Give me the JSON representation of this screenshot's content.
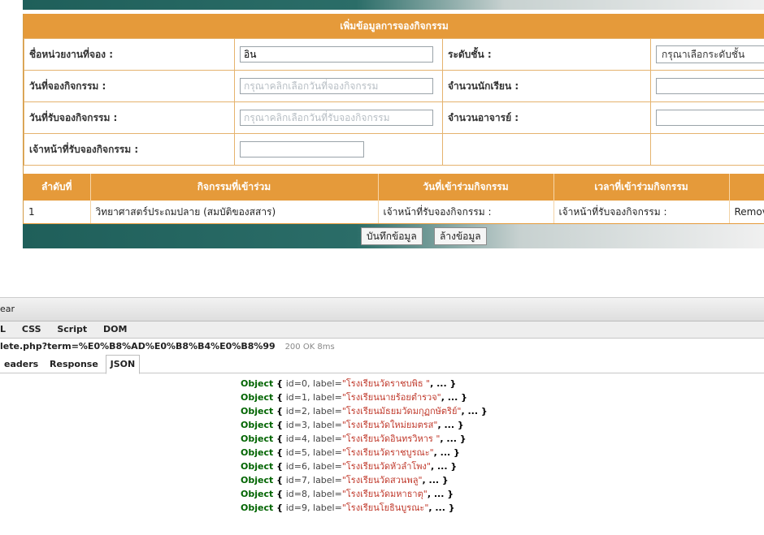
{
  "form": {
    "header": "เพิ่มข้อมูลการจองกิจกรรม",
    "rows": [
      {
        "label": "ชื่อหน่วยงานที่จอง :",
        "value": "อิน",
        "placeholder": "",
        "label2": "ระดับชั้น :",
        "select_value": "กรุณาเลือกระดับชั้น"
      },
      {
        "label": "วันที่จองกิจกรรม :",
        "value": "",
        "placeholder": "กรุณาคลิกเลือกวันที่จองกิจกรรม",
        "label2": "จำนวนนักเรียน :",
        "value2": ""
      },
      {
        "label": "วันที่รับจองกิจกรรม :",
        "value": "",
        "placeholder": "กรุณาคลิกเลือกวันที่รับจองกิจกรรม",
        "label2": "จำนวนอาจารย์ :",
        "value2": ""
      },
      {
        "label": "เจ้าหน้าที่รับจองกิจกรรม :",
        "value": ""
      }
    ]
  },
  "activities": {
    "headers": [
      "ลำดับที่",
      "กิจกรรมที่เข้าร่วม",
      "วันที่เข้าร่วมกิจกรรม",
      "เวลาที่เข้าร่วมกิจกรรม",
      ""
    ],
    "rows": [
      {
        "no": "1",
        "activity": "วิทยาศาสตร์ประถมปลาย (สมบัติของสสาร)",
        "date": "เจ้าหน้าที่รับจองกิจกรรม :",
        "time": "เจ้าหน้าที่รับจองกิจกรรม :",
        "action": "Remove"
      }
    ]
  },
  "buttons": {
    "save": "บันทึกข้อมูล",
    "clear": "ล้างข้อมูล"
  },
  "devtools": {
    "toolbar_text": "ear",
    "tabs": [
      "L",
      "CSS",
      "Script",
      "DOM"
    ],
    "request_url": "lete.php?term=%E0%B8%AD%E0%B8%B4%E0%B8%99",
    "status": "200 OK 8ms",
    "subtabs": [
      "eaders",
      "Response",
      "JSON"
    ],
    "json_items": [
      {
        "id": "0",
        "label": "โรงเรียนวัดราชบพิธ "
      },
      {
        "id": "1",
        "label": "โรงเรียนนายร้อยตำรวจ"
      },
      {
        "id": "2",
        "label": "โรงเรียนมัธยมวัดมกุฏกษัตริย์"
      },
      {
        "id": "3",
        "label": "โรงเรียนวัดใหม่ยมตรส"
      },
      {
        "id": "4",
        "label": "โรงเรียนวัดอินทรวิหาร "
      },
      {
        "id": "5",
        "label": "โรงเรียนวัดราชบูรณะ"
      },
      {
        "id": "6",
        "label": "โรงเรียนวัดหัวลำโพง"
      },
      {
        "id": "7",
        "label": "โรงเรียนวัดสวนพลู"
      },
      {
        "id": "8",
        "label": "โรงเรียนวัดมหาธาตุ"
      },
      {
        "id": "9",
        "label": "โรงเรียนโยธินบูรณะ"
      }
    ]
  }
}
